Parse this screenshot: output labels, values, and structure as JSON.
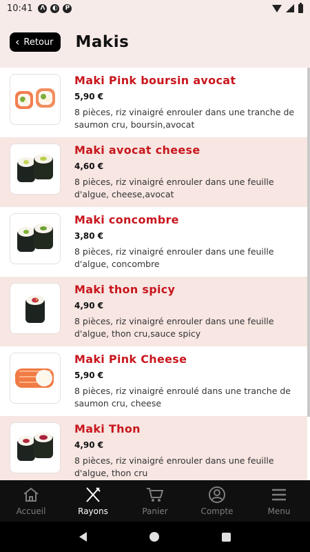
{
  "status": {
    "time": "10:41"
  },
  "header": {
    "back_label": "Retour",
    "title": "Makis"
  },
  "products": [
    {
      "name": "Maki Pink boursin avocat",
      "price": "5,90 €",
      "desc": "8 pièces, riz vinaigré enrouler dans une tranche de saumon cru, boursin,avocat",
      "thumb": "salmon"
    },
    {
      "name": "Maki avocat cheese",
      "price": "4,60 €",
      "desc": "8 pièces, riz vinaigré enrouler dans une feuille d'algue, cheese,avocat",
      "thumb": "avocado"
    },
    {
      "name": "Maki concombre",
      "price": "3,80 €",
      "desc": "8 pièces, riz vinaigré enrouler dans une feuille d'algue, concombre",
      "thumb": "cucumber"
    },
    {
      "name": "Maki thon spicy",
      "price": "4,90 €",
      "desc": "8 pièces, riz vinaigré enrouler dans une feuille d'algue, thon cru,sauce spicy",
      "thumb": "spicy"
    },
    {
      "name": "Maki Pink Cheese",
      "price": "5,90 €",
      "desc": "8 pièces, riz vinaigré enroulé dans une tranche de saumon cru, cheese",
      "thumb": "pink"
    },
    {
      "name": "Maki Thon",
      "price": "4,90 €",
      "desc": "8 pièces, riz vinaigré enrouler dans une feuille d'algue, thon cru",
      "thumb": "tuna"
    }
  ],
  "nav": [
    {
      "label": "Accueil",
      "icon": "home-icon"
    },
    {
      "label": "Rayons",
      "icon": "utensils-icon"
    },
    {
      "label": "Panier",
      "icon": "cart-icon"
    },
    {
      "label": "Compte",
      "icon": "user-icon"
    },
    {
      "label": "Menu",
      "icon": "hamburger-icon"
    }
  ],
  "colors": {
    "accent": "#c8161d",
    "header_bg": "#f7ebe9",
    "alt_row": "#f7e6e2",
    "nav_bg": "#101010"
  }
}
